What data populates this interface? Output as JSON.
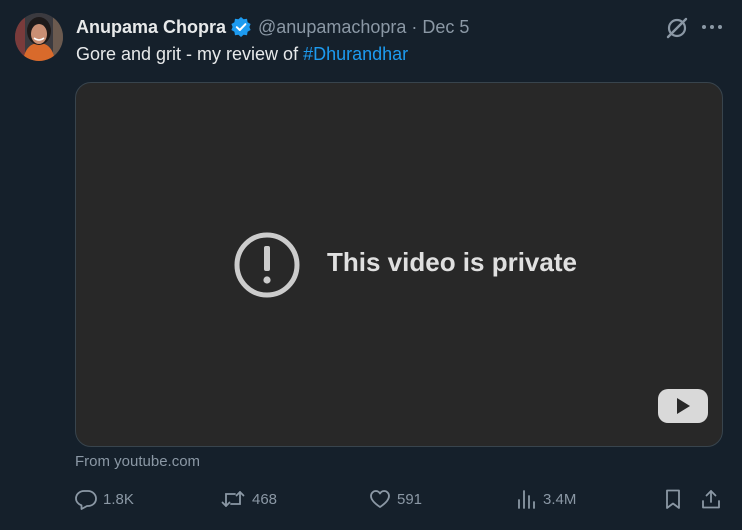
{
  "tweet": {
    "author": {
      "name": "Anupama Chopra",
      "handle": "@anupamachopra",
      "separator": "·",
      "date": "Dec 5"
    },
    "text_prefix": "Gore and grit - my review of ",
    "hashtag": "#Dhurandhar",
    "embed": {
      "message": "This video is private",
      "source": "From youtube.com"
    },
    "actions": {
      "replies": "1.8K",
      "reposts": "468",
      "likes": "591",
      "views": "3.4M"
    }
  },
  "colors": {
    "background": "#15202b",
    "accent": "#1d9bf0",
    "secondary_text": "#8b98a5",
    "video_bg": "#282828"
  },
  "icons": {
    "verified": "verified-badge-icon",
    "grok": "grok-icon",
    "more": "more-icon",
    "alert": "alert-circle-icon",
    "play": "youtube-play-icon",
    "reply": "reply-icon",
    "repost": "repost-icon",
    "like": "heart-icon",
    "views": "views-icon",
    "bookmark": "bookmark-icon",
    "share": "share-icon"
  }
}
